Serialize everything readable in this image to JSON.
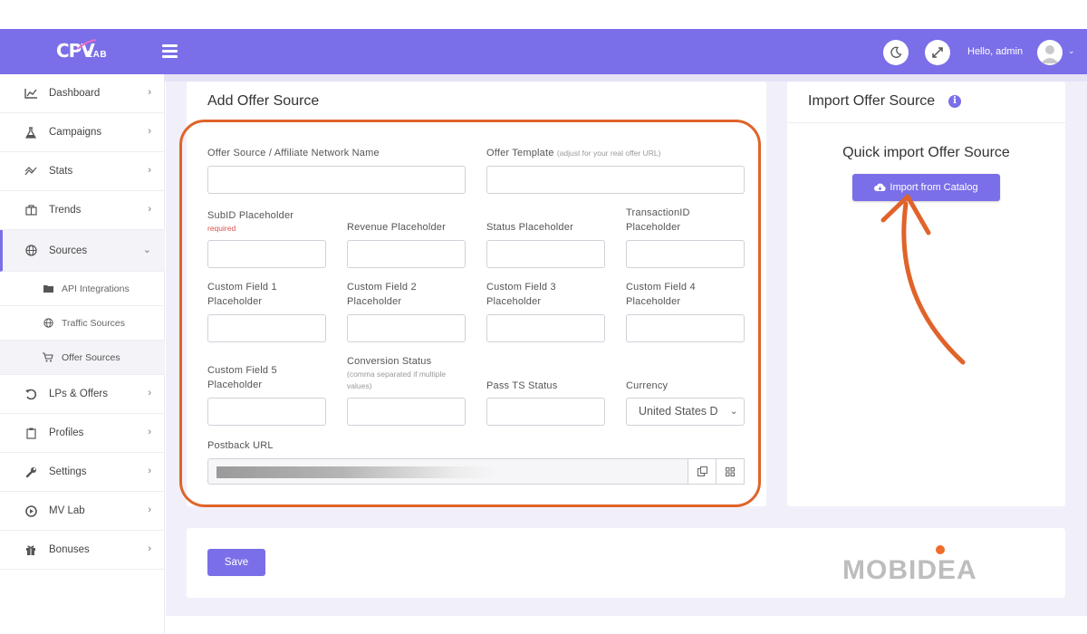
{
  "app": {
    "logo_text": "CPV",
    "logo_sub": "LAB",
    "greeting": "Hello, admin",
    "accent_color": "#7a6fe8",
    "highlight_color": "#e0632a"
  },
  "sidebar": {
    "items": [
      {
        "label": "Dashboard",
        "icon": "chart-line-icon"
      },
      {
        "label": "Campaigns",
        "icon": "flask-icon"
      },
      {
        "label": "Stats",
        "icon": "stats-icon"
      },
      {
        "label": "Trends",
        "icon": "trends-icon"
      },
      {
        "label": "Sources",
        "icon": "globe-icon"
      },
      {
        "label": "LPs & Offers",
        "icon": "lps-icon"
      },
      {
        "label": "Profiles",
        "icon": "clipboard-icon"
      },
      {
        "label": "Settings",
        "icon": "wrench-icon"
      },
      {
        "label": "MV Lab",
        "icon": "mvlab-icon"
      },
      {
        "label": "Bonuses",
        "icon": "gift-icon"
      }
    ],
    "sub_items": [
      {
        "label": "API Integrations",
        "icon": "folder-icon"
      },
      {
        "label": "Traffic Sources",
        "icon": "globe-icon"
      },
      {
        "label": "Offer Sources",
        "icon": "cart-icon"
      }
    ]
  },
  "form": {
    "title": "Add Offer Source",
    "network_name_label": "Offer Source / Affiliate Network Name",
    "template_label": "Offer Template",
    "template_hint": "(adjust for your real offer URL)",
    "subid_label": "SubID Placeholder",
    "subid_required": "required",
    "revenue_label": "Revenue Placeholder",
    "status_label": "Status Placeholder",
    "transaction_label_1": "TransactionID",
    "transaction_label_2": "Placeholder",
    "cf1_label_1": "Custom Field 1",
    "cf1_label_2": "Placeholder",
    "cf2_label_1": "Custom Field 2",
    "cf2_label_2": "Placeholder",
    "cf3_label_1": "Custom Field 3",
    "cf3_label_2": "Placeholder",
    "cf4_label_1": "Custom Field 4",
    "cf4_label_2": "Placeholder",
    "cf5_label_1": "Custom Field 5",
    "cf5_label_2": "Placeholder",
    "conversion_status_label": "Conversion Status",
    "conversion_status_hint_1": "(comma separated if multiple",
    "conversion_status_hint_2": "values)",
    "pass_ts_label": "Pass TS Status",
    "currency_label": "Currency",
    "currency_value": "United States D",
    "postback_label": "Postback URL"
  },
  "import_card": {
    "title": "Import Offer Source",
    "heading": "Quick import Offer Source",
    "button": "Import from Catalog"
  },
  "footer": {
    "save": "Save",
    "brand": "MOBIDEA"
  }
}
